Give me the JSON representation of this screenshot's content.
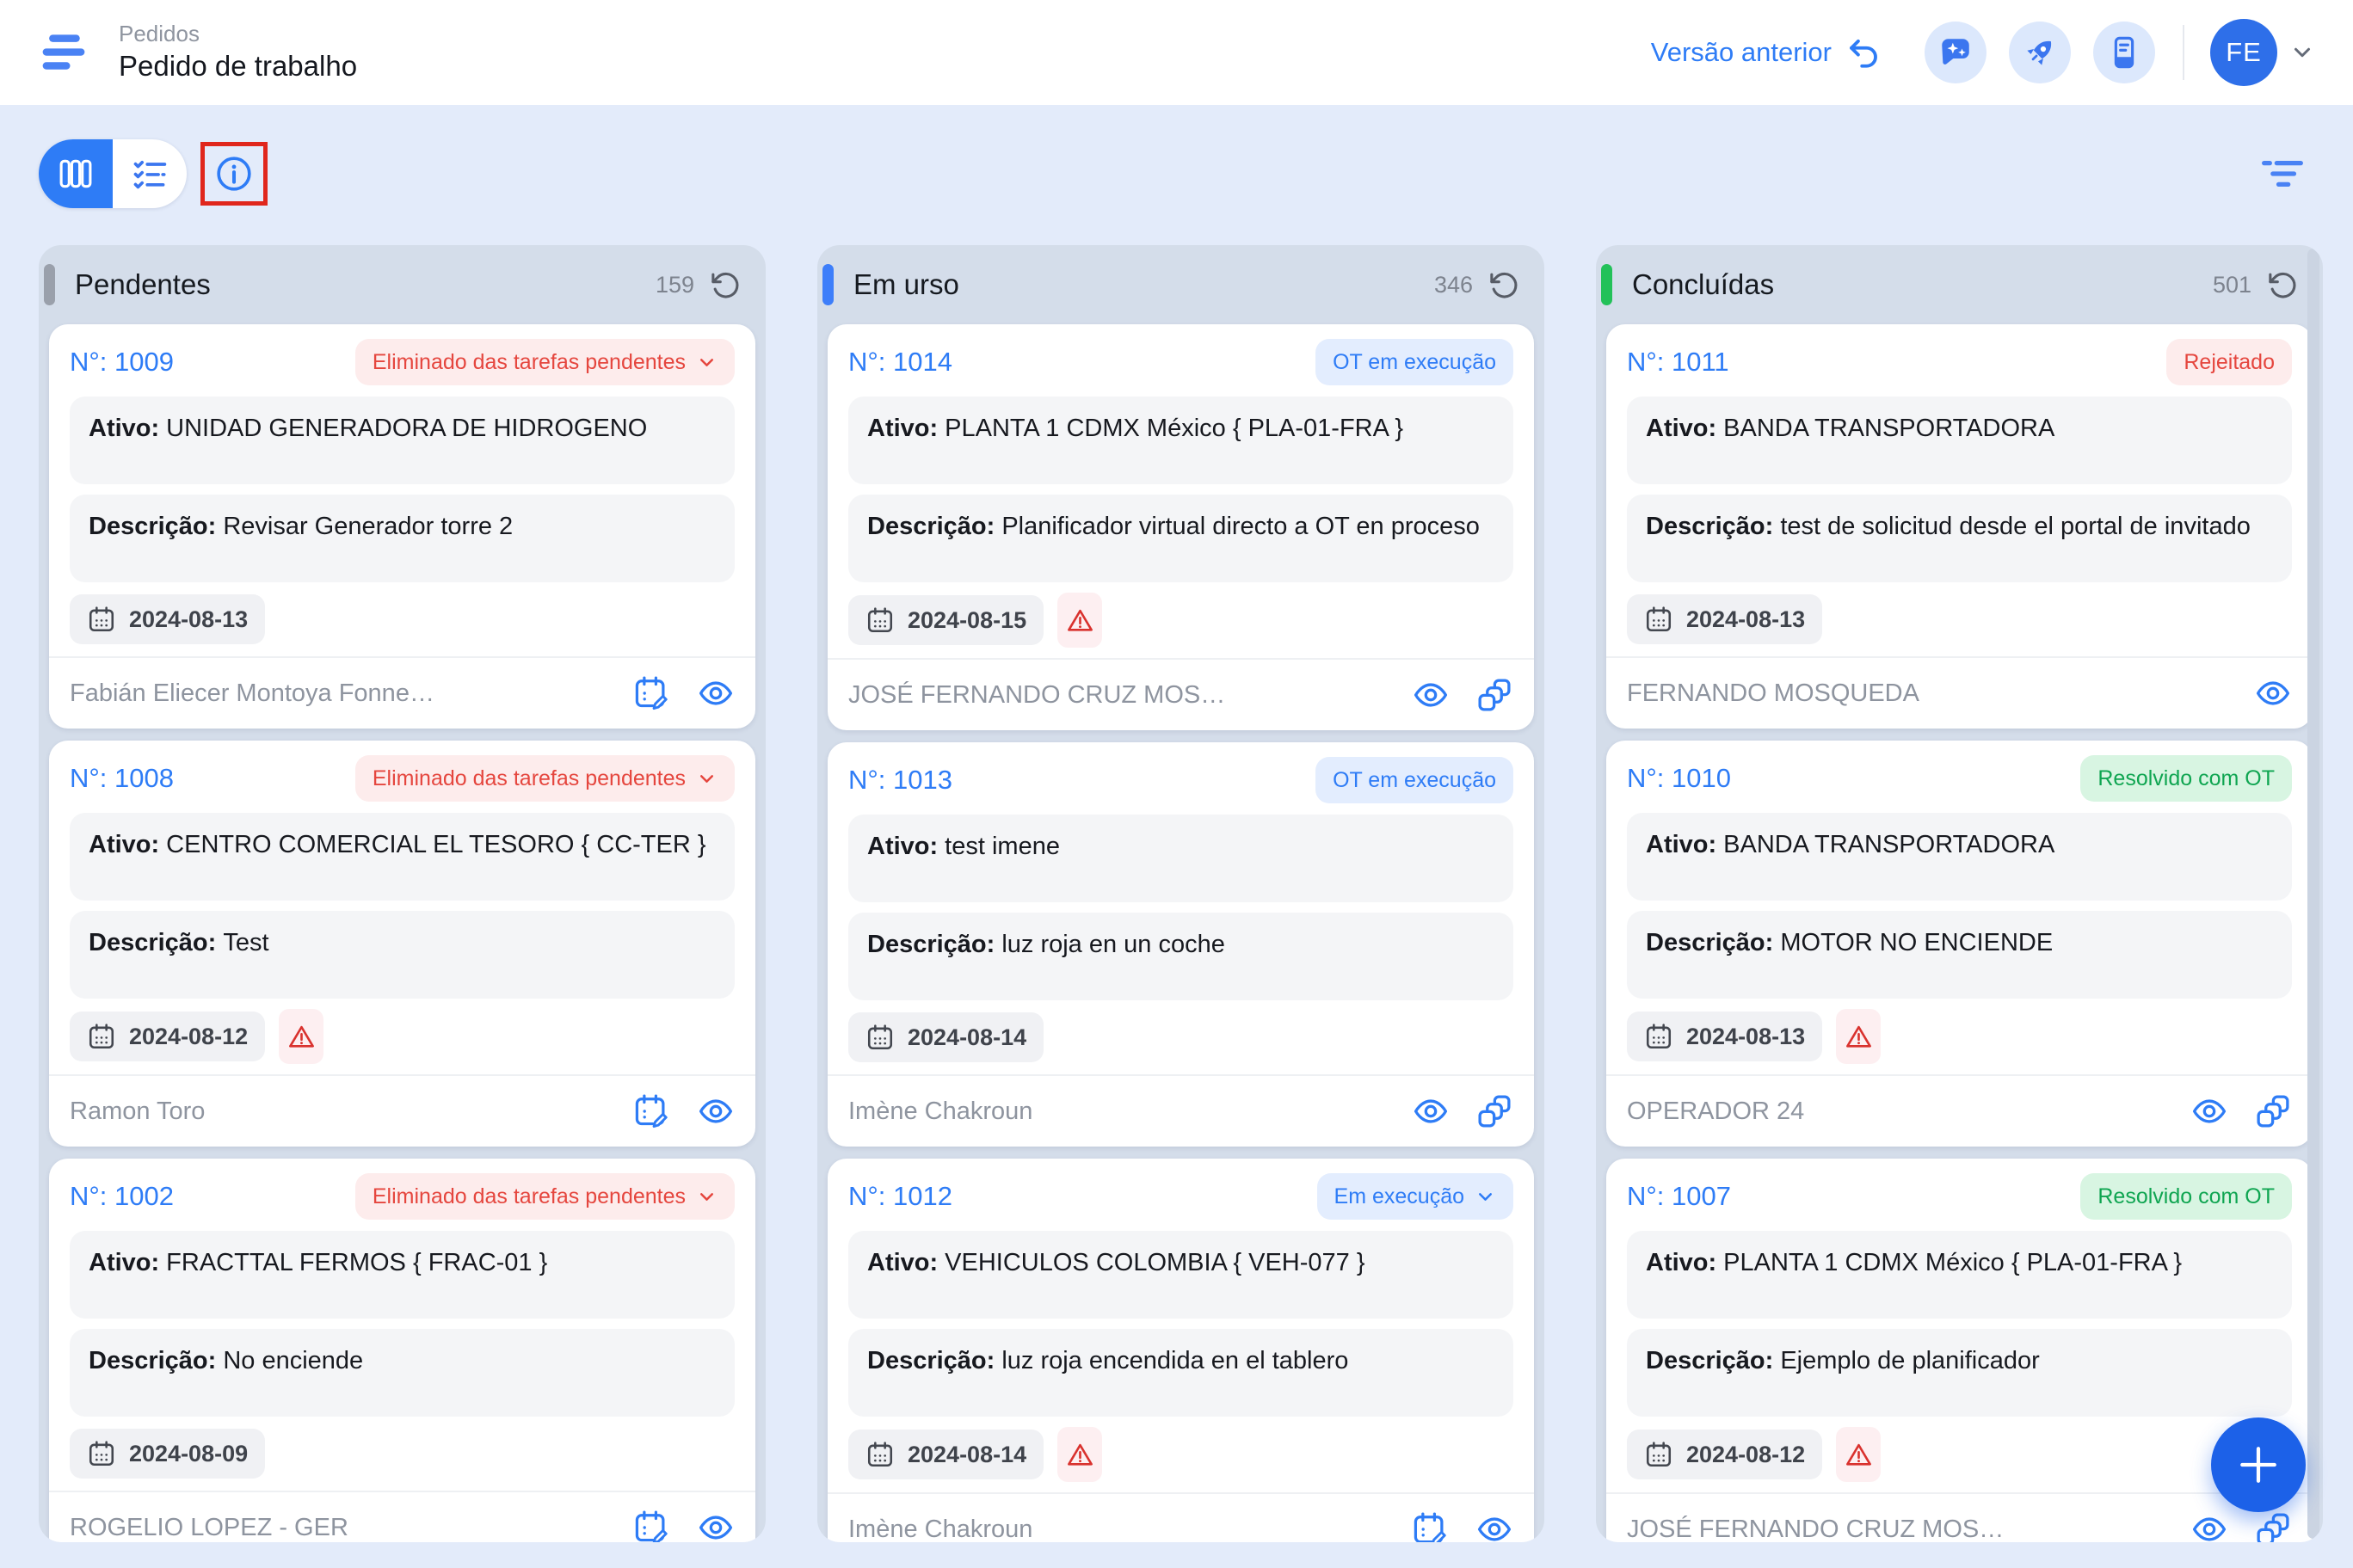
{
  "header": {
    "breadcrumb": "Pedidos",
    "title": "Pedido de trabalho",
    "previous_version": "Versão anterior",
    "avatar_initials": "FE"
  },
  "labels": {
    "asset": "Ativo:",
    "description": "Descrição:"
  },
  "fab": {
    "label": "+"
  },
  "colors": {
    "accent_blue": "#2e7cf6",
    "fab_blue": "#1c61e8",
    "column_bg": "#d4ddea",
    "page_bg": "#e3ebfa",
    "badge_red_text": "#e5463e",
    "badge_red_bg": "#fdecec",
    "badge_blue_text": "#2e7cf6",
    "badge_blue_bg": "#e3edfe",
    "badge_green_text": "#0fa551",
    "badge_green_bg": "#d8f5e2",
    "annotation_box": "#e0261c",
    "pending_accent": "#9aa0ab",
    "in_progress_accent": "#3d7efa",
    "done_accent": "#23c159"
  },
  "columns": [
    {
      "title": "Pendentes",
      "count": "159",
      "accent_color": "#9aa0ab",
      "cards": [
        {
          "number": "N°: 1009",
          "badge": {
            "label": "Eliminado das tarefas pendentes",
            "type": "red",
            "has_chevron": true
          },
          "asset": "UNIDAD GENERADORA DE HIDROGENO",
          "description": "Revisar Generador torre 2",
          "date": "2024-08-13",
          "overdue": false,
          "assignee": "Fabián Eliecer Montoya Fonne…",
          "footer_icons": [
            "calendar-edit",
            "eye"
          ]
        },
        {
          "number": "N°: 1008",
          "badge": {
            "label": "Eliminado das tarefas pendentes",
            "type": "red",
            "has_chevron": true
          },
          "asset": "CENTRO COMERCIAL EL TESORO  { CC-TER }",
          "description": "Test",
          "date": "2024-08-12",
          "overdue": true,
          "assignee": "Ramon Toro",
          "footer_icons": [
            "calendar-edit",
            "eye"
          ]
        },
        {
          "number": "N°: 1002",
          "badge": {
            "label": "Eliminado das tarefas pendentes",
            "type": "red",
            "has_chevron": true
          },
          "asset": "FRACTTAL FERMOS  { FRAC-01 }",
          "description": "No enciende",
          "date": "2024-08-09",
          "overdue": false,
          "assignee": "ROGELIO LOPEZ - GER",
          "footer_icons": [
            "calendar-edit",
            "eye"
          ]
        }
      ]
    },
    {
      "title": "Em urso",
      "count": "346",
      "accent_color": "#3d7efa",
      "cards": [
        {
          "number": "N°: 1014",
          "badge": {
            "label": "OT em execução",
            "type": "blue",
            "has_chevron": false
          },
          "asset": "PLANTA 1 CDMX México { PLA-01-FRA }",
          "description": "Planificador virtual directo a OT en proceso",
          "date": "2024-08-15",
          "overdue": true,
          "assignee": "JOSÉ FERNANDO CRUZ MOS…",
          "footer_icons": [
            "eye",
            "link"
          ]
        },
        {
          "number": "N°: 1013",
          "badge": {
            "label": "OT em execução",
            "type": "blue",
            "has_chevron": false
          },
          "asset": "test imene",
          "description": "luz roja en un coche",
          "date": "2024-08-14",
          "overdue": false,
          "assignee": "Imène Chakroun",
          "footer_icons": [
            "eye",
            "link"
          ]
        },
        {
          "number": "N°: 1012",
          "badge": {
            "label": "Em execução",
            "type": "blue",
            "has_chevron": true
          },
          "asset": "VEHICULOS  COLOMBIA { VEH-077 }",
          "description": "luz roja encendida en el tablero",
          "date": "2024-08-14",
          "overdue": true,
          "assignee": "Imène Chakroun",
          "footer_icons": [
            "calendar-edit",
            "eye"
          ]
        }
      ]
    },
    {
      "title": "Concluídas",
      "count": "501",
      "accent_color": "#23c159",
      "cards": [
        {
          "number": "N°: 1011",
          "badge": {
            "label": "Rejeitado",
            "type": "red",
            "has_chevron": false
          },
          "asset": "BANDA TRANSPORTADORA",
          "description": "test de solicitud desde el portal de invitado",
          "date": "2024-08-13",
          "overdue": false,
          "assignee": "FERNANDO MOSQUEDA",
          "footer_icons": [
            "eye"
          ]
        },
        {
          "number": "N°: 1010",
          "badge": {
            "label": "Resolvido com OT",
            "type": "green",
            "has_chevron": false
          },
          "asset": "BANDA TRANSPORTADORA",
          "description": "MOTOR NO ENCIENDE",
          "date": "2024-08-13",
          "overdue": true,
          "assignee": "OPERADOR 24",
          "footer_icons": [
            "eye",
            "link"
          ]
        },
        {
          "number": "N°: 1007",
          "badge": {
            "label": "Resolvido com OT",
            "type": "green",
            "has_chevron": false
          },
          "asset": "PLANTA 1 CDMX México { PLA-01-FRA }",
          "description": "Ejemplo de planificador",
          "date": "2024-08-12",
          "overdue": true,
          "assignee": "JOSÉ FERNANDO CRUZ MOS…",
          "footer_icons": [
            "eye",
            "link"
          ]
        }
      ]
    }
  ]
}
